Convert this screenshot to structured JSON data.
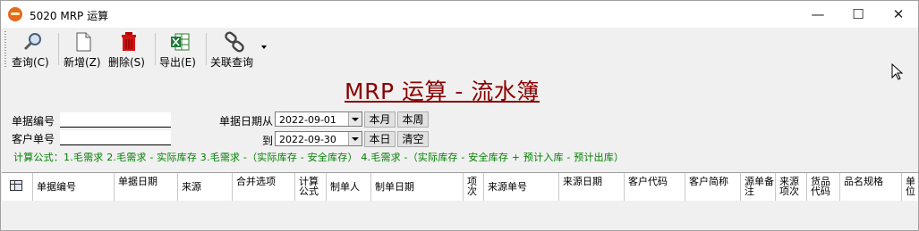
{
  "window": {
    "title": "5020 MRP 运算",
    "controls": {
      "minimize": "—",
      "maximize": "☐",
      "close": "✕"
    }
  },
  "toolbar": {
    "items": [
      {
        "label": "查询(C)",
        "icon": "magnifier-icon"
      },
      {
        "label": "新增(Z)",
        "icon": "new-document-icon"
      },
      {
        "label": "删除(S)",
        "icon": "trash-icon"
      },
      {
        "label": "导出(E)",
        "icon": "excel-icon"
      },
      {
        "label": "关联查询",
        "icon": "link-chain-icon"
      }
    ]
  },
  "heading": "MRP 运算 - 流水簿",
  "form": {
    "doc_no_label": "单据编号",
    "doc_no_value": "",
    "customer_label": "客户单号",
    "customer_value": "",
    "date_from_label": "单据日期从",
    "date_from_value": "2022-09-01",
    "date_to_label": "到",
    "date_to_value": "2022-09-30",
    "btn_this_month": "本月",
    "btn_this_week": "本周",
    "btn_today": "本日",
    "btn_clear": "清空"
  },
  "formula": "计算公式：1.毛需求  2.毛需求 - 实际库存  3.毛需求 -（实际库存 - 安全库存） 4.毛需求 -（实际库存 - 安全库存 + 预计入库 - 预计出库）",
  "grid": {
    "columns": [
      "单据编号",
      "单据日期",
      "来源",
      "合并选项",
      "计算公式",
      "制单人",
      "制单日期",
      "项次",
      "来源单号",
      "来源日期",
      "客户代码",
      "客户简称",
      "源单备注",
      "来源项次",
      "货品代码",
      "品名规格",
      "单位"
    ],
    "rows": []
  },
  "colors": {
    "heading": "#8b0000",
    "formula": "#008000",
    "app_icon": "#e66a1c"
  }
}
